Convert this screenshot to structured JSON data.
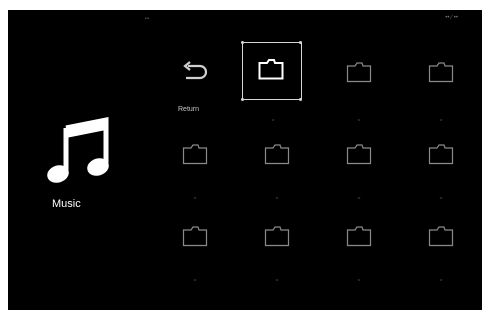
{
  "status": {
    "left_text": "••",
    "right_text": "•• ⁄ ••"
  },
  "category": {
    "label": "Music",
    "icon": "music-note-icon"
  },
  "grid": {
    "return_label": "Return",
    "tiles": [
      {
        "label": "••",
        "icon": "folder-icon",
        "selected": true
      },
      {
        "label": "••",
        "icon": "folder-icon"
      },
      {
        "label": "••",
        "icon": "folder-icon"
      },
      {
        "label": "••",
        "icon": "folder-icon"
      },
      {
        "label": "••",
        "icon": "folder-icon"
      },
      {
        "label": "••",
        "icon": "folder-icon"
      },
      {
        "label": "••",
        "icon": "folder-icon"
      },
      {
        "label": "••",
        "icon": "folder-icon"
      },
      {
        "label": "••",
        "icon": "folder-icon"
      },
      {
        "label": "••",
        "icon": "folder-icon"
      },
      {
        "label": "••",
        "icon": "folder-icon"
      }
    ]
  },
  "colors": {
    "background": "#000000",
    "foreground": "#ffffff",
    "selection": "#d6d6d6"
  }
}
